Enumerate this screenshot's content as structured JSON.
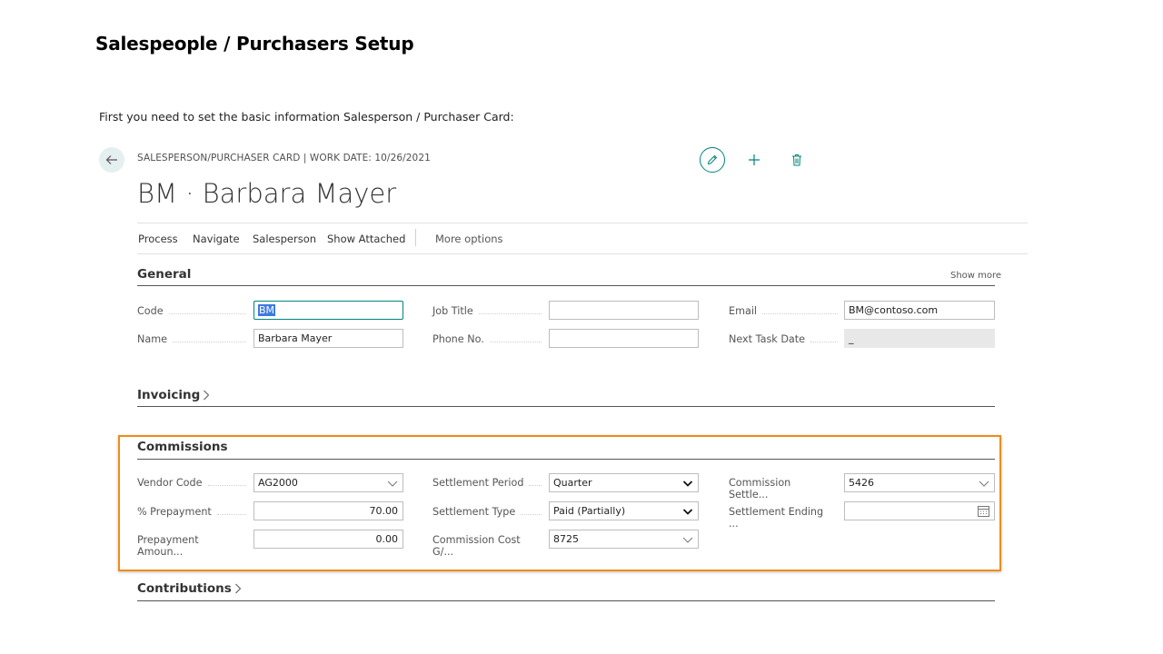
{
  "doc": {
    "title": "Salespeople / Purchasers Setup",
    "intro": "First you need to set the basic information Salesperson / Purchaser Card:"
  },
  "card": {
    "breadcrumb": "SALESPERSON/PURCHASER CARD | WORK DATE: 10/26/2021",
    "title": "BM · Barbara Mayer",
    "icons": {
      "back": "back-arrow-icon",
      "edit": "pencil-icon",
      "add": "plus-icon",
      "delete": "trash-icon"
    },
    "accent_color": "#00847c"
  },
  "action_bar": {
    "process": "Process",
    "navigate": "Navigate",
    "salesperson": "Salesperson",
    "show_attached": "Show Attached",
    "more_options": "More options"
  },
  "general": {
    "title": "General",
    "show_more": "Show more",
    "code_label": "Code",
    "code_value": "BM",
    "name_label": "Name",
    "name_value": "Barbara Mayer",
    "job_title_label": "Job Title",
    "job_title_value": "",
    "phone_label": "Phone No.",
    "phone_value": "",
    "email_label": "Email",
    "email_value": "BM@contoso.com",
    "next_task_label": "Next Task Date",
    "next_task_value": "_"
  },
  "invoicing": {
    "title": "Invoicing"
  },
  "commissions": {
    "title": "Commissions",
    "highlight_color": "#ef8c1a",
    "vendor_code_label": "Vendor Code",
    "vendor_code_value": "AG2000",
    "prepayment_pct_label": "% Prepayment",
    "prepayment_pct_value": "70.00",
    "prepayment_amount_label": "Prepayment Amoun...",
    "prepayment_amount_value": "0.00",
    "settlement_period_label": "Settlement Period",
    "settlement_period_value": "Quarter",
    "settlement_type_label": "Settlement Type",
    "settlement_type_value": "Paid (Partially)",
    "commission_cost_label": "Commission Cost G/...",
    "commission_cost_value": "8725",
    "commission_settle_label": "Commission Settle...",
    "commission_settle_value": "5426",
    "settlement_ending_label": "Settlement Ending ...",
    "settlement_ending_value": ""
  },
  "contributions": {
    "title": "Contributions"
  }
}
